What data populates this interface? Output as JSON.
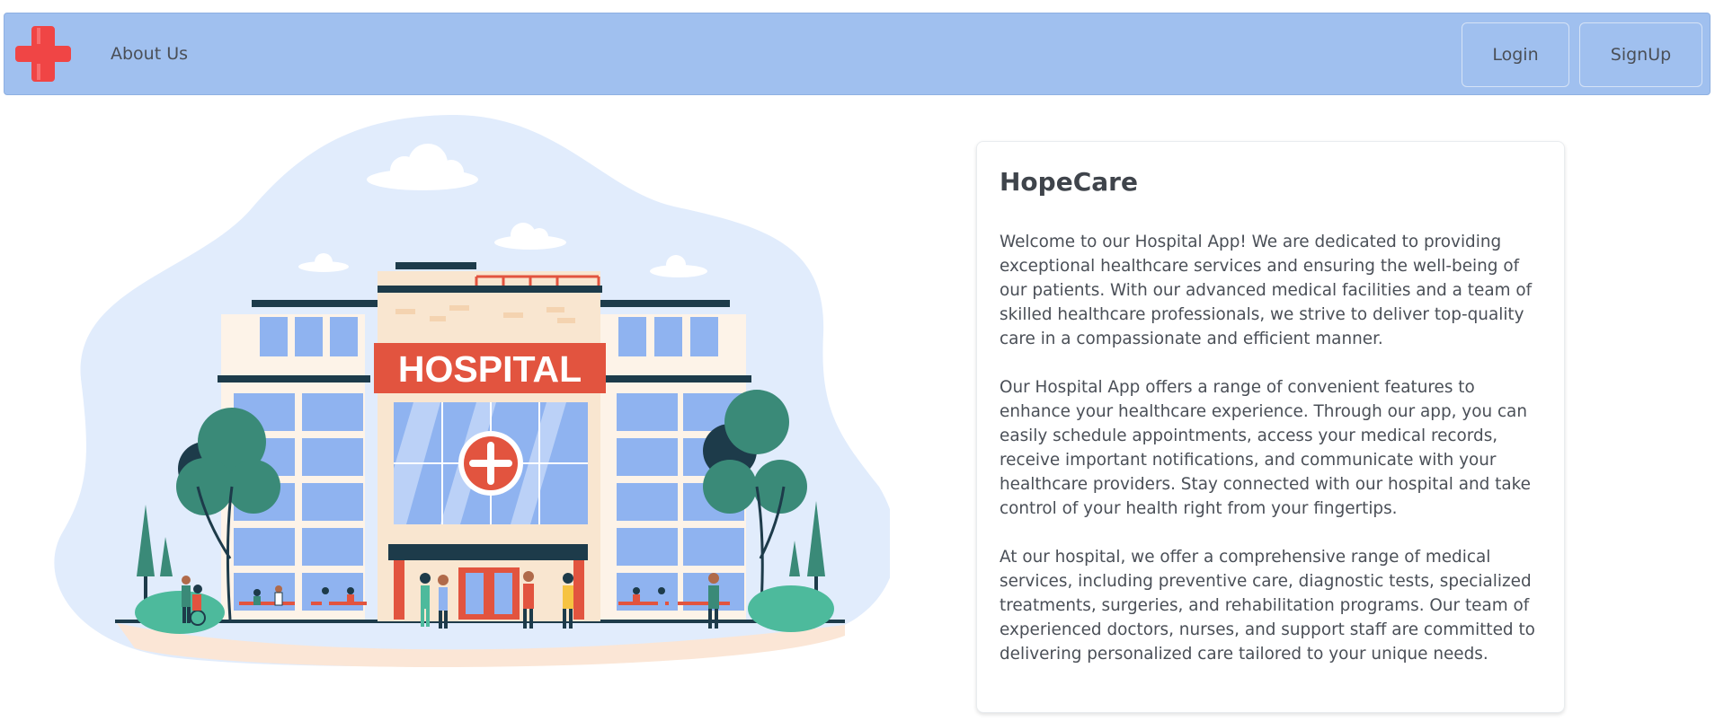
{
  "navbar": {
    "logo": "red-cross-logo",
    "about_label": "About Us",
    "login_label": "Login",
    "signup_label": "SignUp"
  },
  "illustration": {
    "sign_text": "HOSPITAL"
  },
  "card": {
    "title": "HopeCare",
    "paragraphs": [
      "Welcome to our Hospital App! We are dedicated to providing exceptional healthcare services and ensuring the well-being of our patients. With our advanced medical facilities and a team of skilled healthcare professionals, we strive to deliver top-quality care in a compassionate and efficient manner.",
      "Our Hospital App offers a range of convenient features to enhance your healthcare experience. Through our app, you can easily schedule appointments, access your medical records, receive important notifications, and communicate with your healthcare providers. Stay connected with our hospital and take control of your health right from your fingertips.",
      "At our hospital, we offer a comprehensive range of medical services, including preventive care, diagnostic tests, specialized treatments, surgeries, and rehabilitation programs. Our team of experienced doctors, nurses, and support staff are committed to delivering personalized care tailored to your unique needs."
    ]
  },
  "colors": {
    "navbar_bg": "#a0c0ef",
    "logo_red": "#f04545",
    "sign_red": "#e2543f",
    "tree_green": "#3a8a78",
    "window_blue": "#8fb3f0"
  }
}
